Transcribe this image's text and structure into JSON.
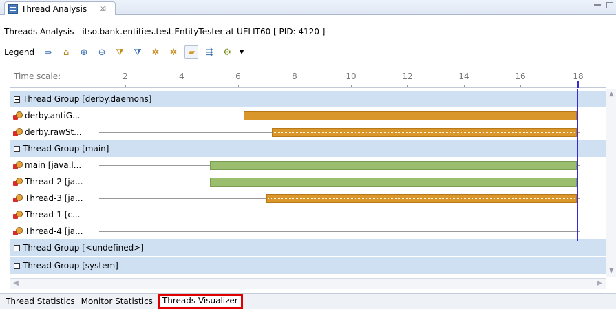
{
  "tab": {
    "title": "Thread Analysis",
    "close": "☒"
  },
  "header": {
    "text": "Threads Analysis - itso.bank.entities.test.EntityTester at UELIT60 [ PID: 4120 ]"
  },
  "toolbar": {
    "legend_label": "Legend",
    "icons": [
      "expand-all-icon",
      "home-icon",
      "zoom-in-icon",
      "zoom-out-icon",
      "filter-icon",
      "filter-alt-icon",
      "thread-view-icon",
      "thread-view-alt-icon",
      "open-folder-icon",
      "split-icon",
      "group-threads-icon",
      "dropdown-arrow-icon"
    ]
  },
  "timescale": {
    "label": "Time scale:",
    "ticks": [
      "2",
      "4",
      "6",
      "8",
      "10",
      "12",
      "14",
      "16",
      "18"
    ]
  },
  "groups": [
    {
      "label": "Thread Group [derby.daemons]",
      "expanded": true
    },
    {
      "label": "Thread Group [main]",
      "expanded": true
    },
    {
      "label": "Thread Group [<undefined>]",
      "expanded": false
    },
    {
      "label": "Thread Group [system]",
      "expanded": false
    }
  ],
  "threads": [
    {
      "label": "derby.antiG...",
      "bar_color": "#d9962b",
      "start": 6.2,
      "end": 18
    },
    {
      "label": "derby.rawSt...",
      "bar_color": "#d9962b",
      "start": 7.2,
      "end": 18
    },
    {
      "label": "main [java.l...",
      "bar_color": "#9abd6e",
      "start": 5.0,
      "end": 18
    },
    {
      "label": "Thread-2 [ja...",
      "bar_color": "#9abd6e",
      "start": 5.0,
      "end": 18
    },
    {
      "label": "Thread-3 [ja...",
      "bar_color": "#d9962b",
      "start": 7.0,
      "end": 18
    },
    {
      "label": "Thread-1 [c...",
      "bar_color": null,
      "start": null,
      "end": null
    },
    {
      "label": "Thread-4 [ja...",
      "bar_color": null,
      "start": null,
      "end": null
    }
  ],
  "bottom_tabs": [
    "Thread Statistics",
    "Monitor Statistics",
    "Threads Visualizer"
  ],
  "colors": {
    "group_bg": "#cfe0f3",
    "running": "#9abd6e",
    "waiting": "#d9962b",
    "highlight": "#e00000",
    "time_marker": "#3a2ad6"
  }
}
